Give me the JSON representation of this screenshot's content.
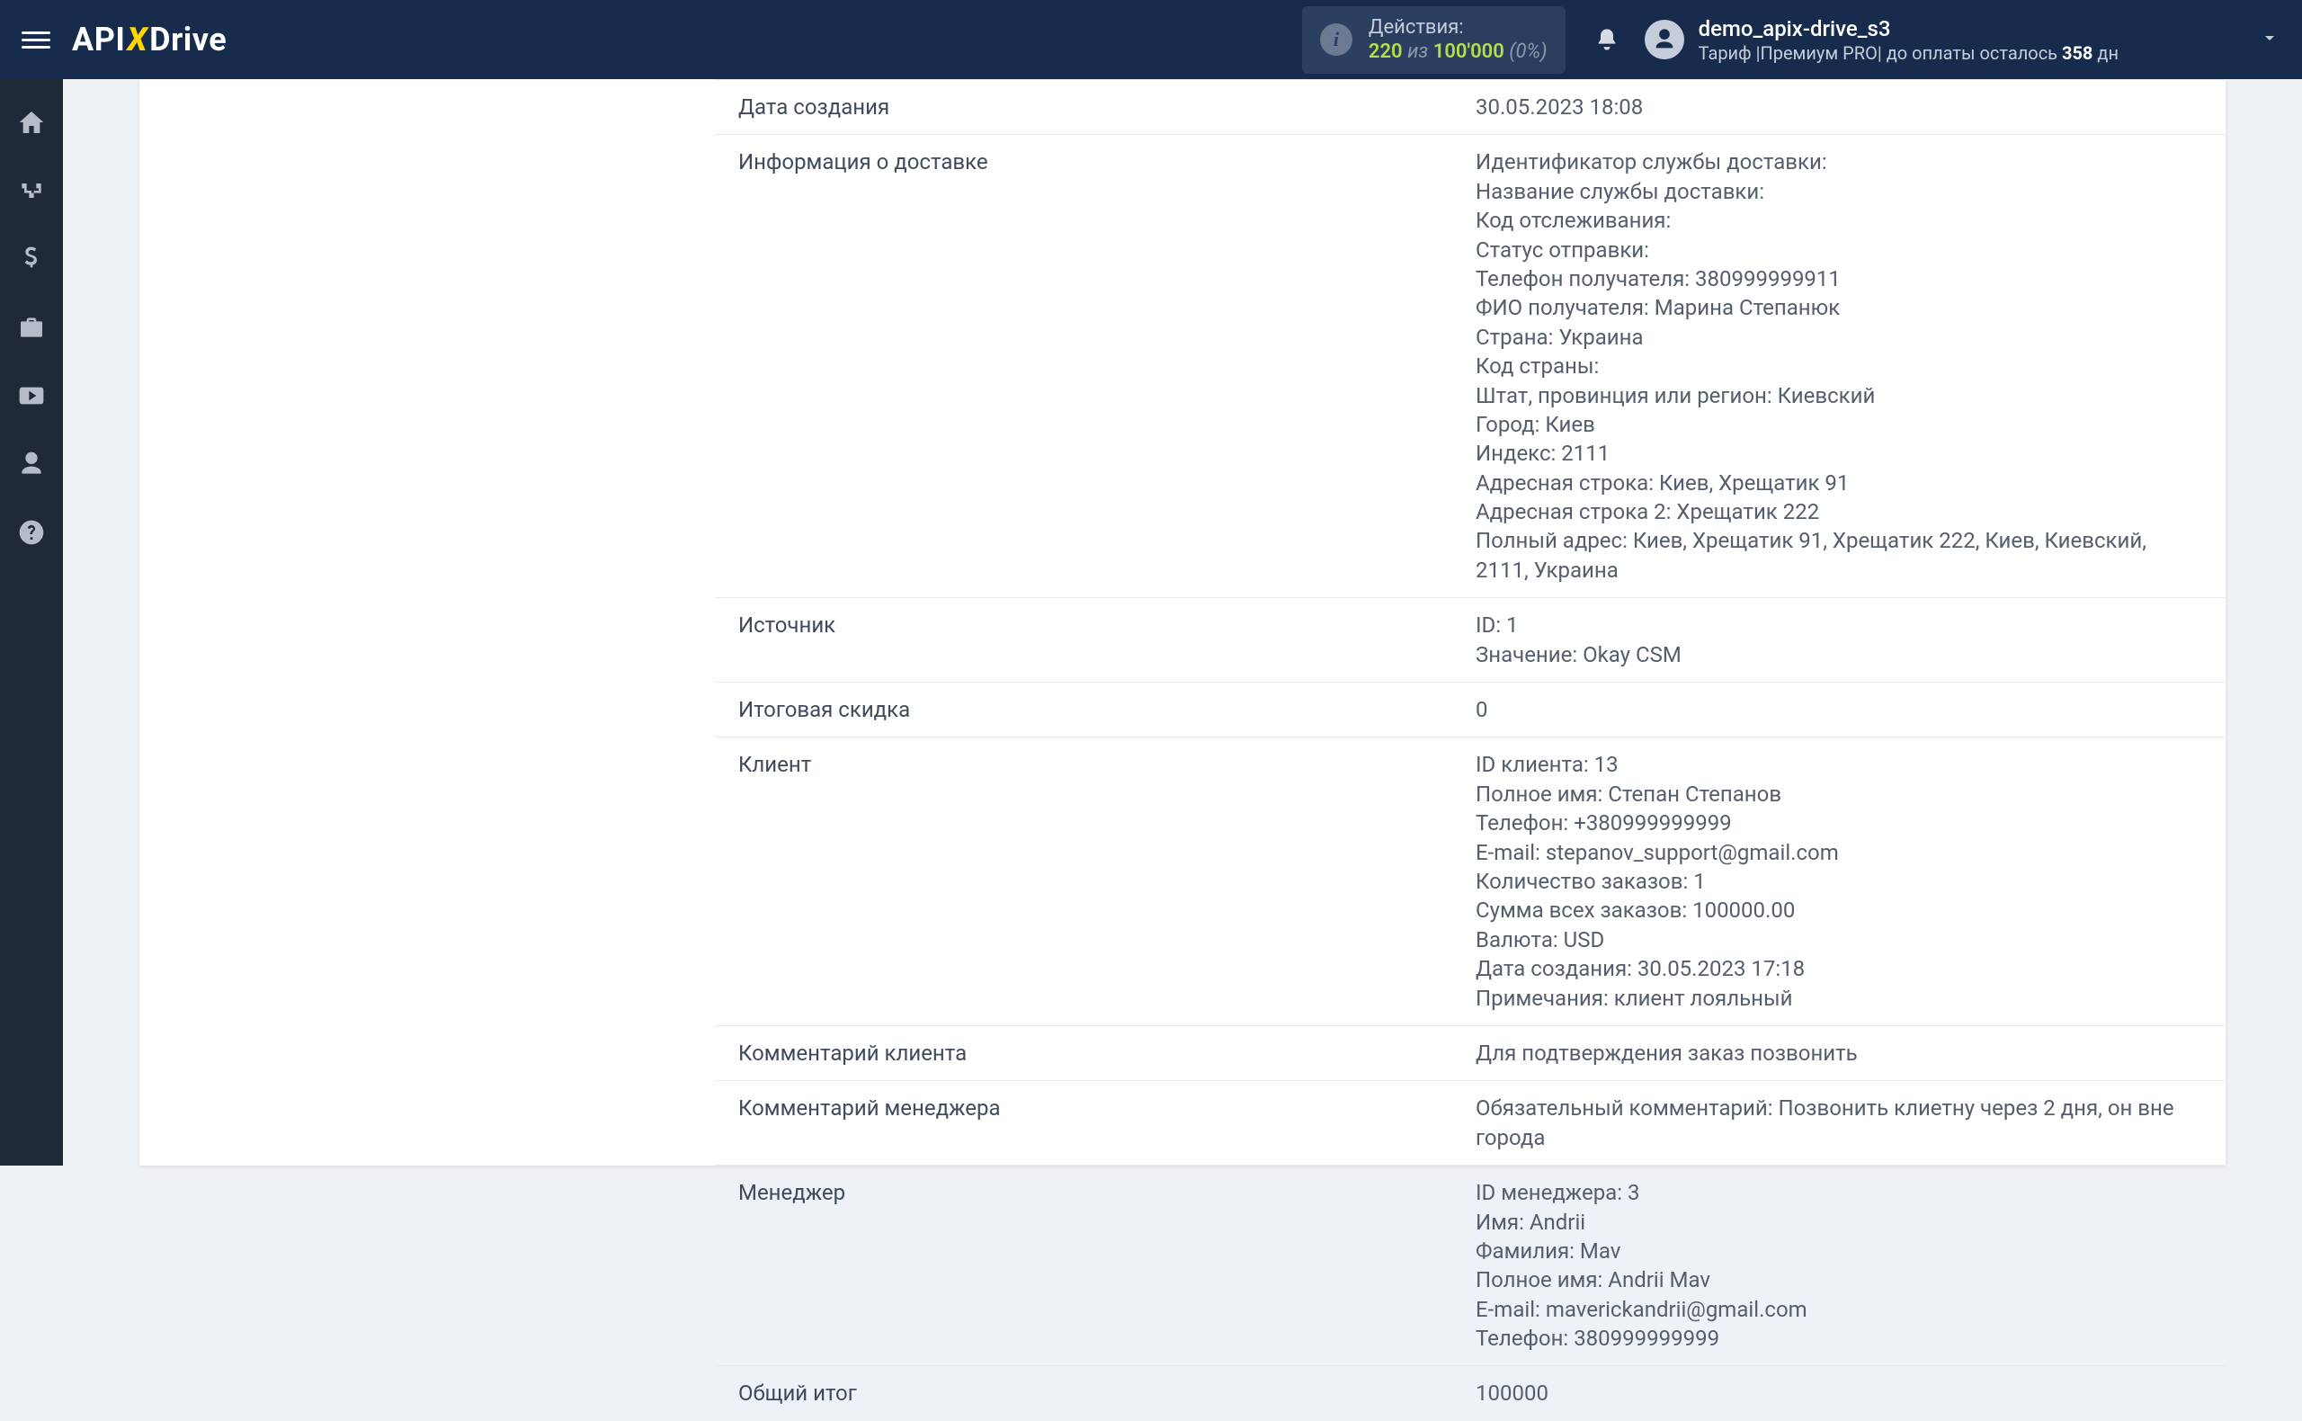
{
  "header": {
    "logo_api": "API",
    "logo_drive": "Drive",
    "actions_label": "Действия:",
    "actions_current": "220",
    "actions_of": "из",
    "actions_max": "100'000",
    "actions_pct": "(0%)",
    "user_name": "demo_apix-drive_s3",
    "user_plan_prefix": "Тариф |Премиум PRO| до оплаты осталось ",
    "user_plan_days": "358",
    "user_plan_suffix": " дн"
  },
  "rows": [
    {
      "label": "Дата создания",
      "value": "30.05.2023 18:08"
    },
    {
      "label": "Информация о доставке",
      "value": "Идентификатор службы доставки:\nНазвание службы доставки:\nКод отслеживания:\nСтатус отправки:\nТелефон получателя: 380999999911\nФИО получателя: Марина Степанюк\nСтрана: Украина\nКод страны:\nШтат, провинция или регион: Киевский\nГород: Киев\nИндекс: 2111\nАдресная строка: Киев, Хрещатик 91\nАдресная строка 2: Хрещатик 222\nПолный адрес: Киев, Хрещатик 91, Хрещатик 222, Киев, Киевский, 2111, Украина"
    },
    {
      "label": "Источник",
      "value": "ID: 1\nЗначение: Okay CSM"
    },
    {
      "label": "Итоговая скидка",
      "value": "0"
    },
    {
      "label": "Клиент",
      "value": "ID клиента: 13\nПолное имя: Степан Степанов\nТелефон: +380999999999\nE-mail: stepanov_support@gmail.com\nКоличество заказов: 1\nСумма всех заказов: 100000.00\nВалюта: USD\nДата создания: 30.05.2023 17:18\nПримечания: клиент лояльный"
    },
    {
      "label": "Комментарий клиента",
      "value": "Для подтверждения заказ позвонить"
    },
    {
      "label": "Комментарий менеджера",
      "value": "Обязательный комментарий: Позвонить клиетну через 2 дня, он вне города"
    },
    {
      "label": "Менеджер",
      "value": "ID менеджера: 3\nИмя: Andrii\nФамилия: Mav\nПолное имя: Andrii Mav\nE-mail: maverickandrii@gmail.com\nТелефон: 380999999999"
    },
    {
      "label": "Общий итог",
      "value": "100000"
    }
  ]
}
